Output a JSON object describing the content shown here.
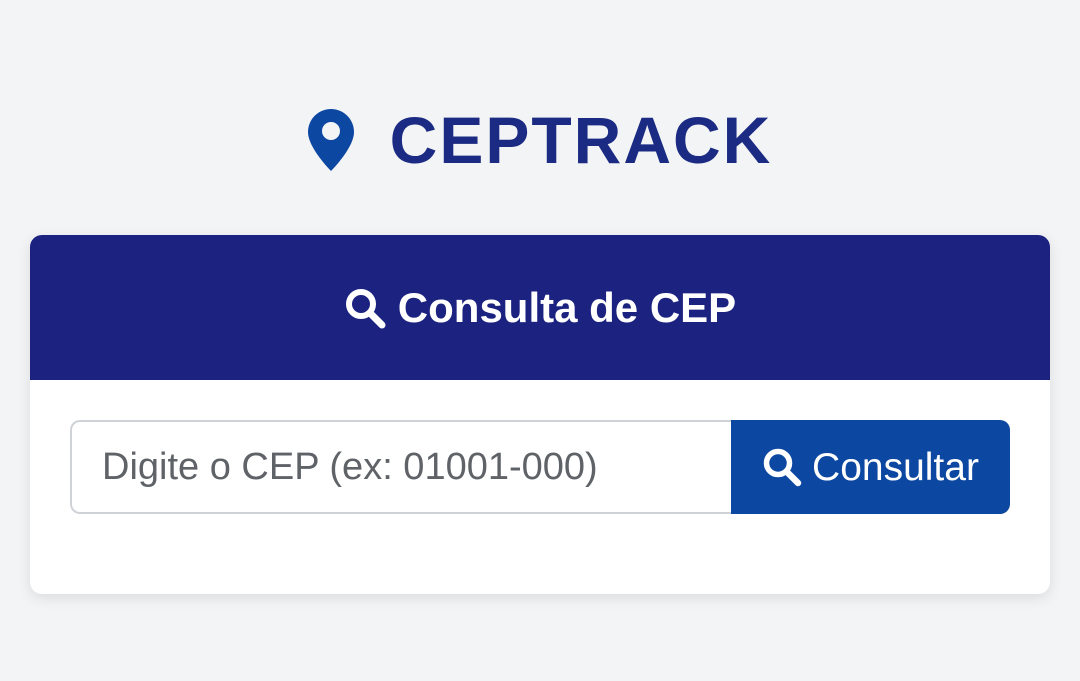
{
  "brand": {
    "icon": "map-pin-icon",
    "title": "CEPTRACK",
    "color": "#1b2a82"
  },
  "card": {
    "header": {
      "icon": "search-icon",
      "title": "Consulta de CEP",
      "background": "#1b2280"
    },
    "search": {
      "placeholder": "Digite o CEP (ex: 01001-000)",
      "value": "",
      "button_icon": "search-icon",
      "button_label": "Consultar",
      "button_color": "#0c47a1"
    }
  }
}
